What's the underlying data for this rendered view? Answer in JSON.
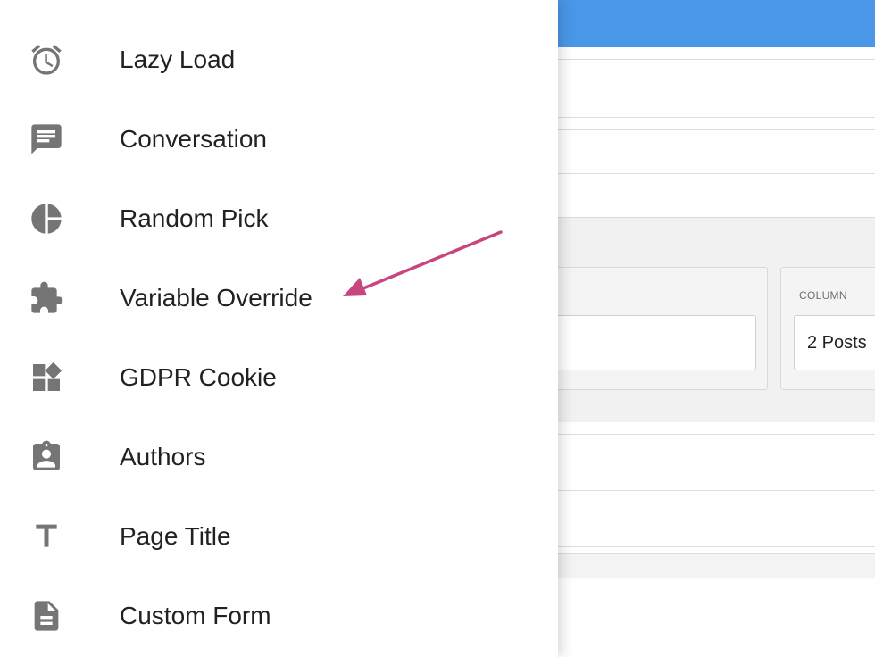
{
  "menu": {
    "items": [
      {
        "label": "Lazy Load",
        "icon": "alarm-clock-icon"
      },
      {
        "label": "Conversation",
        "icon": "chat-bubble-icon"
      },
      {
        "label": "Random Pick",
        "icon": "pie-chart-icon"
      },
      {
        "label": "Variable Override",
        "icon": "puzzle-piece-icon"
      },
      {
        "label": "GDPR Cookie",
        "icon": "widgets-icon"
      },
      {
        "label": "Authors",
        "icon": "assignment-ind-icon"
      },
      {
        "label": "Page Title",
        "icon": "text-icon"
      },
      {
        "label": "Custom Form",
        "icon": "document-icon"
      }
    ]
  },
  "editor": {
    "column_label": "COLUMN",
    "column_value": "2 Posts",
    "topbar_color": "#4a97e8"
  },
  "annotation": {
    "arrow_color": "#c8457f",
    "points_to": "Variable Override"
  }
}
